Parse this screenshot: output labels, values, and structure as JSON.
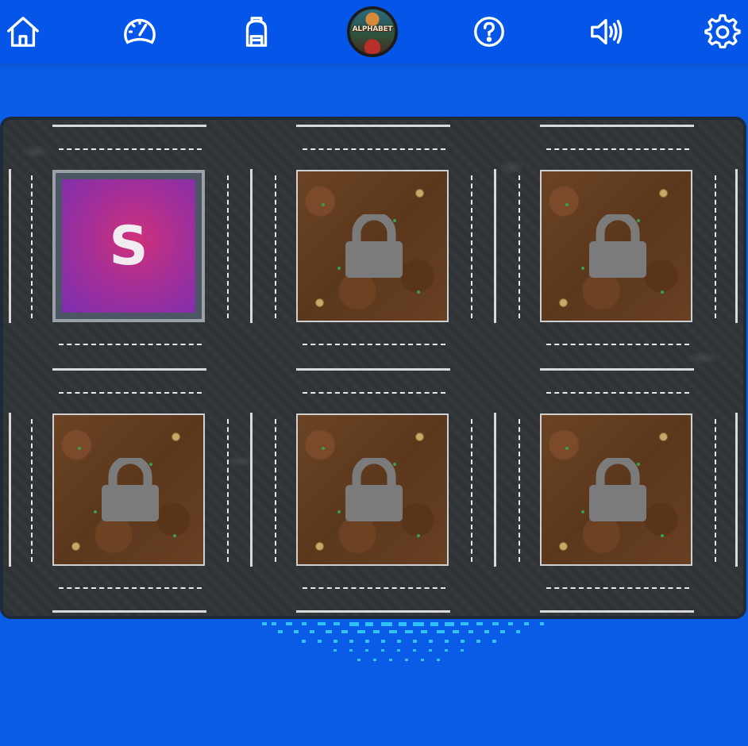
{
  "header": {
    "home_icon": "home-icon",
    "progress_icon": "speedometer-icon",
    "backpack_icon": "backpack-icon",
    "logo": {
      "text": "ALPHABET",
      "icon": "alphabet-logo"
    },
    "help_icon": "help-icon",
    "sound_icon": "speaker-icon",
    "settings_icon": "gear-icon"
  },
  "board": {
    "tiles": [
      {
        "state": "unlocked",
        "letter": "S"
      },
      {
        "state": "locked",
        "icon": "lock-icon"
      },
      {
        "state": "locked",
        "icon": "lock-icon"
      },
      {
        "state": "locked",
        "icon": "lock-icon"
      },
      {
        "state": "locked",
        "icon": "lock-icon"
      },
      {
        "state": "locked",
        "icon": "lock-icon"
      }
    ]
  },
  "colors": {
    "background": "#0a5ce6",
    "topbar": "#0556e8",
    "lock": "#7b7b7b",
    "letter_tile": "#a62f96"
  }
}
